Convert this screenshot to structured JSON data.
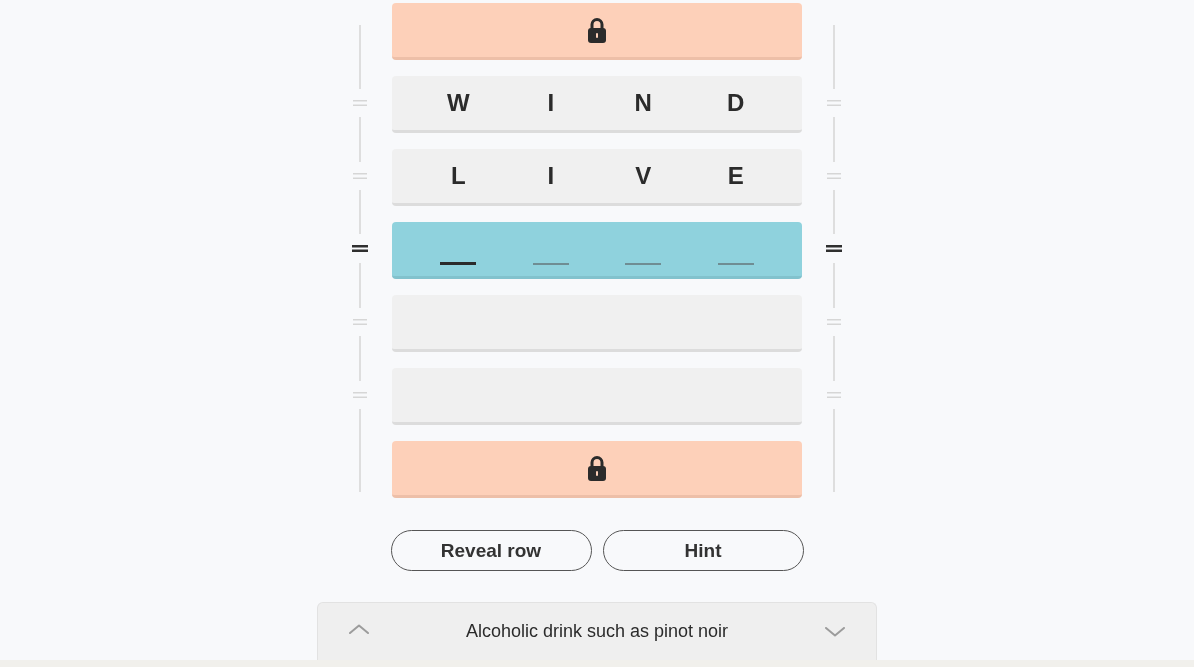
{
  "rows": [
    {
      "kind": "locked",
      "selected": false
    },
    {
      "kind": "word",
      "selected": false,
      "letters": [
        "W",
        "I",
        "N",
        "D"
      ]
    },
    {
      "kind": "word",
      "selected": false,
      "letters": [
        "L",
        "I",
        "V",
        "E"
      ]
    },
    {
      "kind": "entry",
      "selected": true,
      "slots": [
        {
          "selected": true
        },
        {
          "selected": false
        },
        {
          "selected": false
        },
        {
          "selected": false
        }
      ]
    },
    {
      "kind": "empty",
      "selected": false
    },
    {
      "kind": "empty",
      "selected": false
    },
    {
      "kind": "locked",
      "selected": false
    }
  ],
  "buttons": [
    "Reveal row",
    "Hint"
  ],
  "clue": {
    "text": "Alcoholic drink such as pinot noir"
  }
}
